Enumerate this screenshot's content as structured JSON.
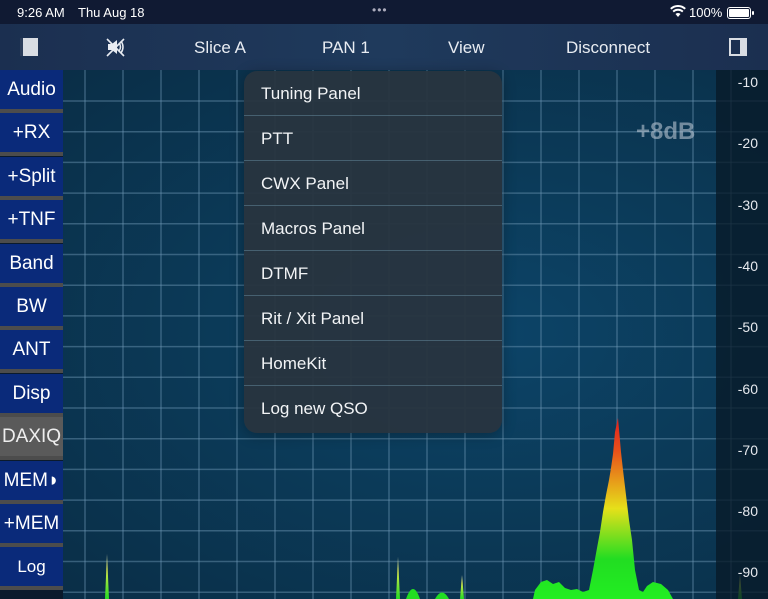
{
  "status_bar": {
    "time": "9:26 AM",
    "date": "Thu Aug 18",
    "more_dots": "•••",
    "battery_percent": "100%",
    "battery_level": 1.0
  },
  "nav_bar": {
    "left_sidebar_toggle_icon": "sidebar-left-icon",
    "mute_icon": "speaker-muted-icon",
    "slice": "Slice A",
    "pan": "PAN 1",
    "view": "View",
    "disconnect": "Disconnect",
    "right_sidebar_toggle_icon": "sidebar-right-icon"
  },
  "sidebar": {
    "buttons": [
      {
        "label": "Audio",
        "active": false
      },
      {
        "label": "+RX",
        "active": false
      },
      {
        "label": "+Split",
        "active": false
      },
      {
        "label": "+TNF",
        "active": false
      },
      {
        "label": "Band",
        "active": false
      },
      {
        "label": "BW",
        "active": false
      },
      {
        "label": "ANT",
        "active": false
      },
      {
        "label": "Disp",
        "active": false
      },
      {
        "label": "DAXIQ",
        "active": true
      },
      {
        "label": "MEM◗",
        "active": false
      },
      {
        "label": "+MEM",
        "active": false
      },
      {
        "label": "Log",
        "active": false
      }
    ]
  },
  "view_menu": {
    "items": [
      "Tuning Panel",
      "PTT",
      "CWX Panel",
      "Macros Panel",
      "DTMF",
      "Rit / Xit Panel",
      "HomeKit",
      "Log new QSO"
    ]
  },
  "panadapter": {
    "gain_label": "+8dB",
    "db_scale": [
      "-10",
      "-20",
      "-30",
      "-40",
      "-50",
      "-60",
      "-70",
      "-80",
      "-90"
    ],
    "colors": {
      "grid": "#6e9ab5",
      "signal_low": "#22dd22",
      "signal_mid": "#e6e01a",
      "signal_high": "#e02020"
    }
  }
}
